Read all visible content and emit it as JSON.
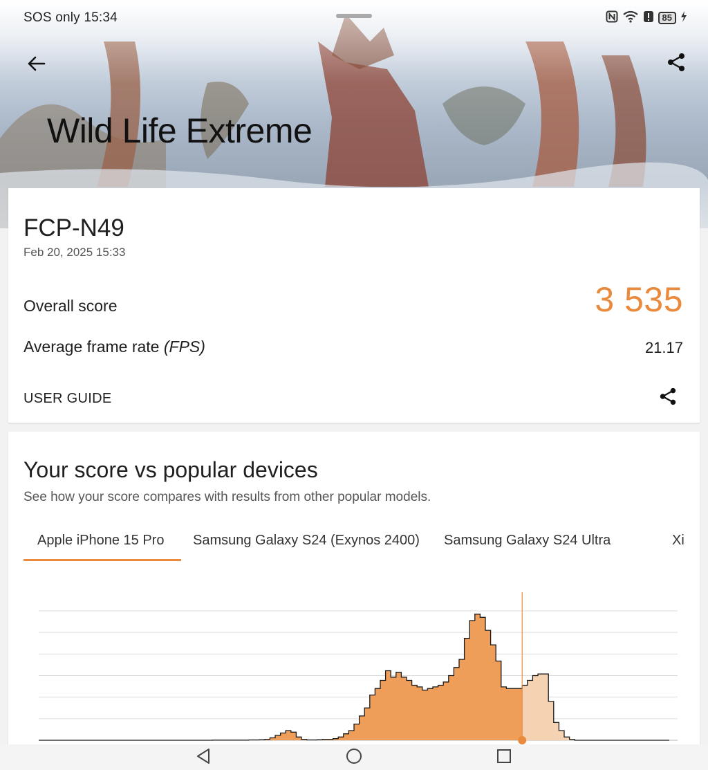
{
  "status_bar": {
    "left_text": "SOS only 15:34",
    "battery_level": "85",
    "icons": [
      "nfc-icon",
      "wifi-icon",
      "alert-icon",
      "battery-icon",
      "charging-icon"
    ]
  },
  "header": {
    "title": "Wild Life Extreme",
    "back_icon": "arrow-left-icon",
    "share_icon": "share-icon"
  },
  "result": {
    "device": "FCP-N49",
    "date": "Feb 20, 2025 15:33",
    "overall_label": "Overall score",
    "overall_value": "3 535",
    "fps_label_main": "Average frame rate ",
    "fps_label_unit": "(FPS)",
    "fps_value": "21.17",
    "guide_label": "USER GUIDE"
  },
  "comparison": {
    "title": "Your score vs popular devices",
    "subtitle": "See how your score compares with results from other popular models.",
    "tabs": [
      {
        "label": "Apple iPhone 15 Pro",
        "selected": true
      },
      {
        "label": "Samsung Galaxy S24 (Exynos 2400)",
        "selected": false
      },
      {
        "label": "Samsung Galaxy S24 Ultra",
        "selected": false
      },
      {
        "label": "Xi",
        "selected": false
      }
    ]
  },
  "chart_data": {
    "type": "area",
    "title": "",
    "xlabel": "",
    "ylabel": "",
    "grid": true,
    "x": [
      0,
      1,
      2,
      3,
      4,
      5,
      6,
      7,
      8,
      9,
      10,
      11,
      12,
      13,
      14,
      15,
      16,
      17,
      18,
      19,
      20,
      21,
      22,
      23,
      24,
      25,
      26,
      27,
      28,
      29,
      30,
      31,
      32,
      33,
      34,
      35,
      36,
      37,
      38,
      39,
      40,
      41,
      42,
      43,
      44,
      45,
      46,
      47,
      48,
      49,
      50,
      51,
      52,
      53,
      54,
      55,
      56,
      57,
      58,
      59,
      60,
      61,
      62,
      63,
      64,
      65,
      66,
      67,
      68,
      69,
      70,
      71,
      72,
      73,
      74,
      75,
      76,
      77,
      78,
      79,
      80,
      81,
      82,
      83,
      84,
      85,
      86,
      87,
      88,
      89,
      90,
      91,
      92,
      93,
      94,
      95,
      96,
      97,
      98,
      99,
      100,
      101,
      102,
      103,
      104,
      105,
      106,
      107,
      108,
      109,
      110,
      111,
      112,
      113,
      114,
      115,
      116,
      117,
      118,
      119
    ],
    "values": [
      0,
      0,
      0,
      0,
      0,
      0,
      0,
      0,
      0,
      0,
      0,
      0,
      0,
      0,
      0,
      0,
      0,
      0,
      0,
      0,
      0,
      0,
      0,
      0,
      0,
      0,
      0,
      0,
      0,
      0,
      0,
      0,
      0,
      0.1,
      0.1,
      0.1,
      0.1,
      0.1,
      0.1,
      0.1,
      0.2,
      0.2,
      0.3,
      0.5,
      1.5,
      3,
      4.5,
      6,
      5,
      2,
      0.5,
      0.2,
      0.2,
      0.3,
      0.5,
      0.5,
      1,
      2,
      4,
      6,
      10,
      15,
      20,
      28,
      32,
      37,
      43,
      39,
      42,
      39,
      37,
      34,
      33,
      31,
      32,
      33,
      34,
      36,
      40,
      45,
      50,
      63,
      74,
      78,
      76,
      68,
      59,
      49,
      33,
      32,
      32,
      32,
      34,
      37,
      40,
      41,
      41,
      24,
      11,
      6,
      2,
      0.5,
      0,
      0,
      0,
      0,
      0,
      0,
      0,
      0,
      0,
      0,
      0,
      0,
      0,
      0,
      0,
      0,
      0,
      0
    ],
    "highlight_index": 92,
    "ylim": [
      0,
      80
    ],
    "accent_color": "#e98a3c",
    "fill_color": "#ef9e59",
    "light_fill_color": "#f5d3b2"
  },
  "nav_bar": {
    "icons": [
      "back-triangle-icon",
      "home-circle-icon",
      "recents-square-icon"
    ]
  }
}
